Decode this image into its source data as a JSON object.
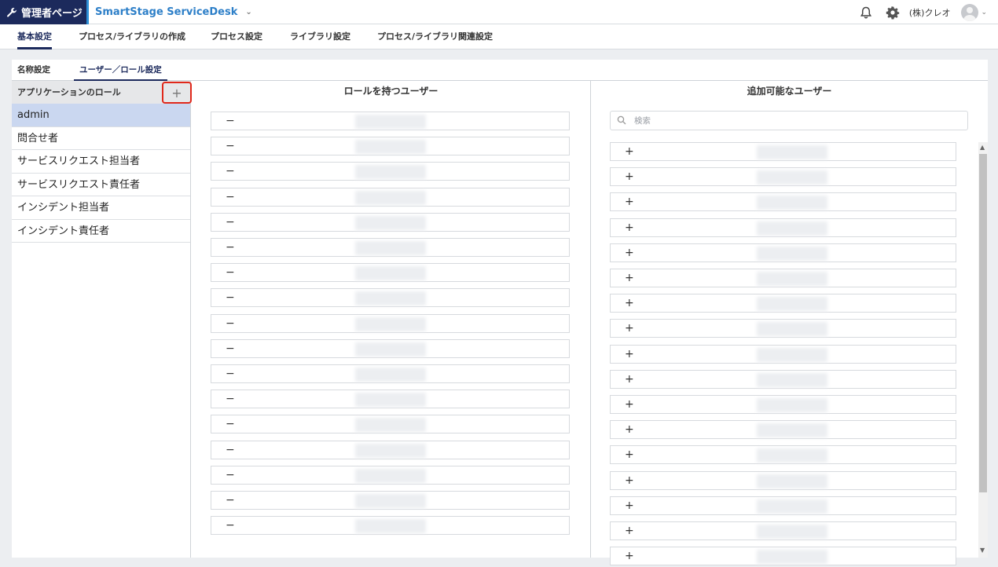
{
  "topbar": {
    "admin_label": "管理者ページ",
    "product": "SmartStage ServiceDesk",
    "company": "(株)クレオ"
  },
  "main_tabs": [
    {
      "label": "基本設定",
      "active": true
    },
    {
      "label": "プロセス/ライブラリの作成",
      "active": false
    },
    {
      "label": "プロセス設定",
      "active": false
    },
    {
      "label": "ライブラリ設定",
      "active": false
    },
    {
      "label": "プロセス/ライブラリ関連設定",
      "active": false
    }
  ],
  "sub_tabs": [
    {
      "label": "名称設定",
      "active": false
    },
    {
      "label": "ユーザー／ロール設定",
      "active": true
    }
  ],
  "roles": {
    "header": "アプリケーションのロール",
    "add_label": "+",
    "items": [
      {
        "label": "admin",
        "selected": true
      },
      {
        "label": "問合せ者",
        "selected": false
      },
      {
        "label": "サービスリクエスト担当者",
        "selected": false
      },
      {
        "label": "サービスリクエスト責任者",
        "selected": false
      },
      {
        "label": "インシデント担当者",
        "selected": false
      },
      {
        "label": "インシデント責任者",
        "selected": false
      }
    ]
  },
  "role_users": {
    "title": "ロールを持つユーザー",
    "remove_label": "−",
    "rows": 17
  },
  "available_users": {
    "title": "追加可能なユーザー",
    "search_placeholder": "検索",
    "add_label": "+",
    "rows": 17
  },
  "colors": {
    "admin_badge": "#1c2a5c",
    "product_text": "#2d7fc8",
    "selected_role": "#cad7f0",
    "highlight_box": "#e0281b"
  },
  "icons": [
    "wrench-icon",
    "chevron-down-icon",
    "bell-icon",
    "gear-icon",
    "avatar-icon",
    "plus-icon",
    "search-icon"
  ]
}
